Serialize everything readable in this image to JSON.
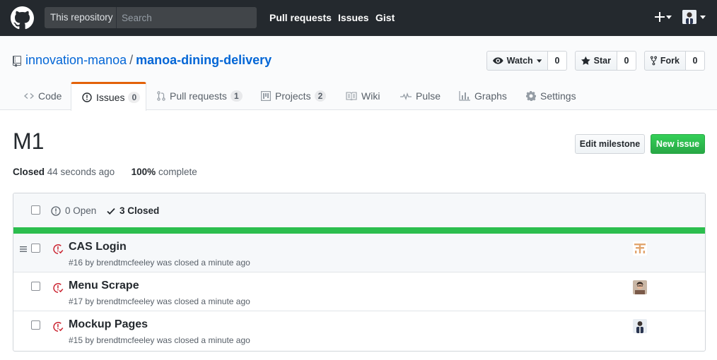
{
  "header": {
    "search_scope": "This repository",
    "search_placeholder": "Search",
    "nav": [
      "Pull requests",
      "Issues",
      "Gist"
    ]
  },
  "repo": {
    "owner": "innovation-manoa",
    "separator": "/",
    "name": "manoa-dining-delivery",
    "watch": {
      "label": "Watch",
      "count": "0"
    },
    "star": {
      "label": "Star",
      "count": "0"
    },
    "fork": {
      "label": "Fork",
      "count": "0"
    }
  },
  "tabs": [
    {
      "label": "Code",
      "icon": "code-icon"
    },
    {
      "label": "Issues",
      "count": "0",
      "icon": "issue-opened-icon",
      "selected": true
    },
    {
      "label": "Pull requests",
      "count": "1",
      "icon": "git-pull-request-icon"
    },
    {
      "label": "Projects",
      "count": "2",
      "icon": "project-icon"
    },
    {
      "label": "Wiki",
      "icon": "book-icon"
    },
    {
      "label": "Pulse",
      "icon": "pulse-icon"
    },
    {
      "label": "Graphs",
      "icon": "graph-icon"
    },
    {
      "label": "Settings",
      "icon": "gear-icon"
    }
  ],
  "milestone": {
    "title": "M1",
    "status": "Closed",
    "closed_ago": "44 seconds ago",
    "percent": "100%",
    "complete_label": "complete",
    "progress": 1.0,
    "edit_label": "Edit milestone",
    "new_issue_label": "New issue"
  },
  "states": {
    "open_label": "0 Open",
    "closed_label": "3 Closed"
  },
  "issues": [
    {
      "title": "CAS Login",
      "meta": "#16 by brendtmcfeeley was closed a minute ago"
    },
    {
      "title": "Menu Scrape",
      "meta": "#17 by brendtmcfeeley was closed a minute ago"
    },
    {
      "title": "Mockup Pages",
      "meta": "#15 by brendtmcfeeley was closed a minute ago"
    }
  ],
  "colors": {
    "header_bg": "#24292e",
    "link": "#0366d6",
    "success": "#28a745",
    "progress": "#2cbe4e",
    "closed_icon": "#cb2431",
    "tab_accent": "#e36209"
  }
}
